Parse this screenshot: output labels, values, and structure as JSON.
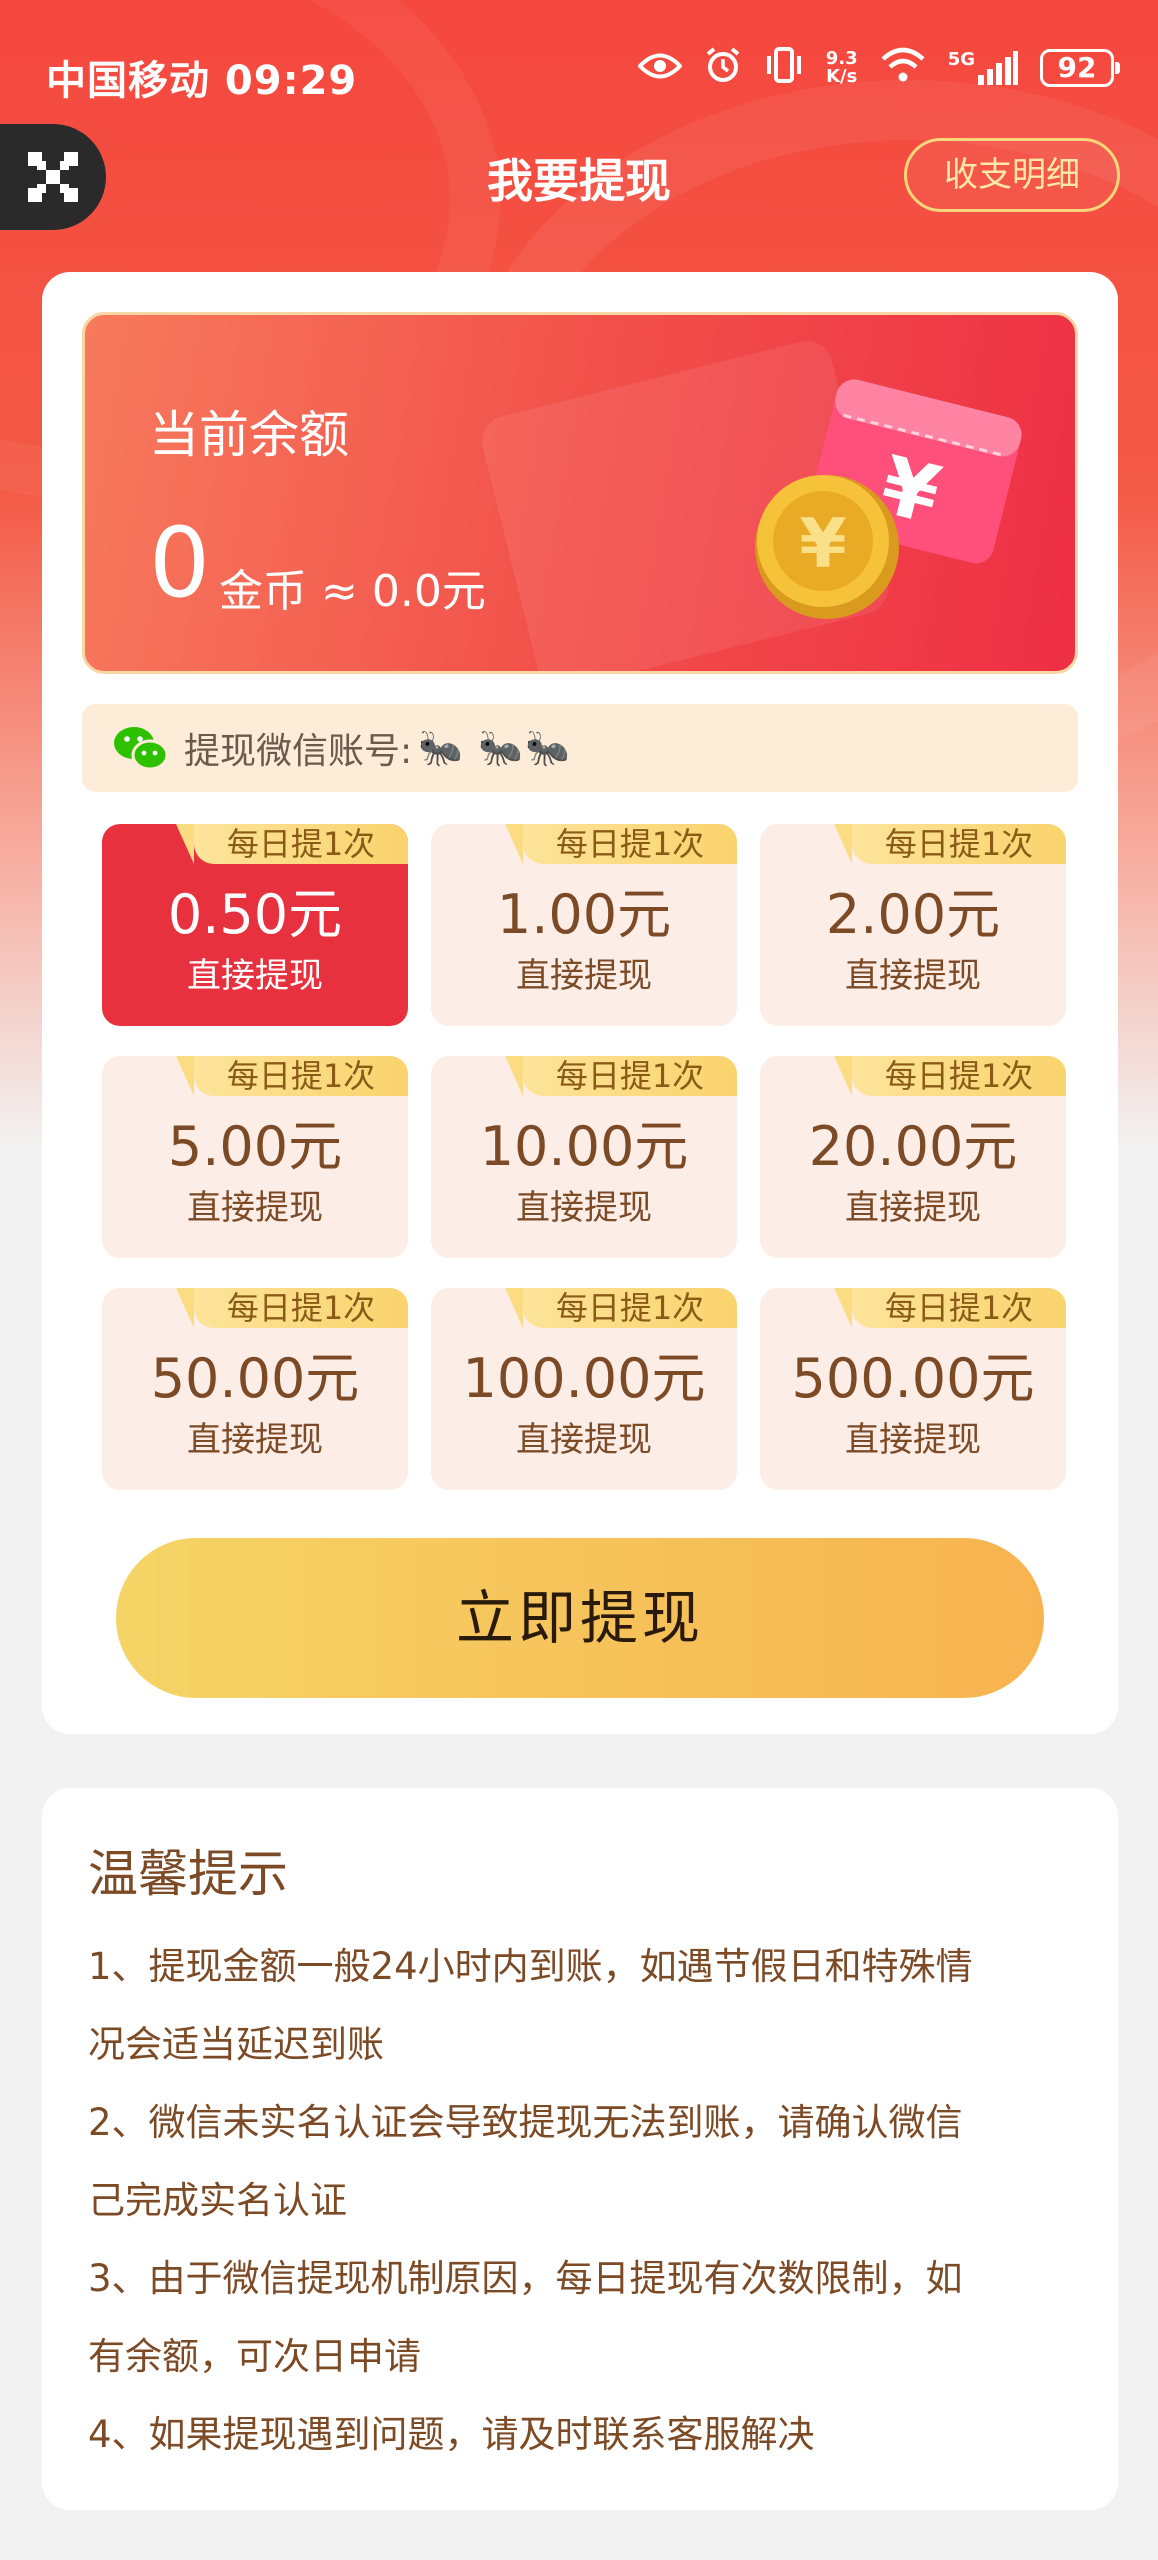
{
  "status_bar": {
    "carrier_time": "中国移动 09:29",
    "net_speed_top": "9.3",
    "net_speed_bottom": "K/s",
    "network": "5G",
    "battery": "92"
  },
  "header": {
    "title": "我要提现",
    "detail_button": "收支明细"
  },
  "balance": {
    "label": "当前余额",
    "amount": "0",
    "unit_text": "金币 ≈ 0.0元"
  },
  "wechat": {
    "label": "提现微信账号:",
    "account_name": "🐜 🐜🐜"
  },
  "options": [
    {
      "tag": "每日提1次",
      "amount": "0.50元",
      "sub": "直接提现",
      "selected": true
    },
    {
      "tag": "每日提1次",
      "amount": "1.00元",
      "sub": "直接提现",
      "selected": false
    },
    {
      "tag": "每日提1次",
      "amount": "2.00元",
      "sub": "直接提现",
      "selected": false
    },
    {
      "tag": "每日提1次",
      "amount": "5.00元",
      "sub": "直接提现",
      "selected": false
    },
    {
      "tag": "每日提1次",
      "amount": "10.00元",
      "sub": "直接提现",
      "selected": false
    },
    {
      "tag": "每日提1次",
      "amount": "20.00元",
      "sub": "直接提现",
      "selected": false
    },
    {
      "tag": "每日提1次",
      "amount": "50.00元",
      "sub": "直接提现",
      "selected": false
    },
    {
      "tag": "每日提1次",
      "amount": "100.00元",
      "sub": "直接提现",
      "selected": false
    },
    {
      "tag": "每日提1次",
      "amount": "500.00元",
      "sub": "直接提现",
      "selected": false
    }
  ],
  "withdraw_button": "立即提现",
  "tips": {
    "title": "温馨提示",
    "items": [
      "1、提现金额一般24小时内到账，如遇节假日和特殊情",
      "况会适当延迟到账",
      "2、微信未实名认证会导致提现无法到账，请确认微信",
      "己完成实名认证",
      "3、由于微信提现机制原因，每日提现有次数限制，如",
      "有余额，可次日申请",
      "4、如果提现遇到问题，请及时联系客服解决"
    ]
  },
  "colors": {
    "header_red": "#f5473e",
    "selected_red": "#e8313e",
    "option_bg": "#fcede7",
    "gold_button_start": "#f5d466",
    "gold_button_end": "#f7b34f",
    "brown_text": "#7d4a26"
  },
  "icons": [
    "eye-icon",
    "alarm-icon",
    "vibrate-icon",
    "wifi-icon",
    "signal-icon",
    "battery-icon",
    "close-icon",
    "coin-ticket-illustration",
    "wechat-icon"
  ]
}
